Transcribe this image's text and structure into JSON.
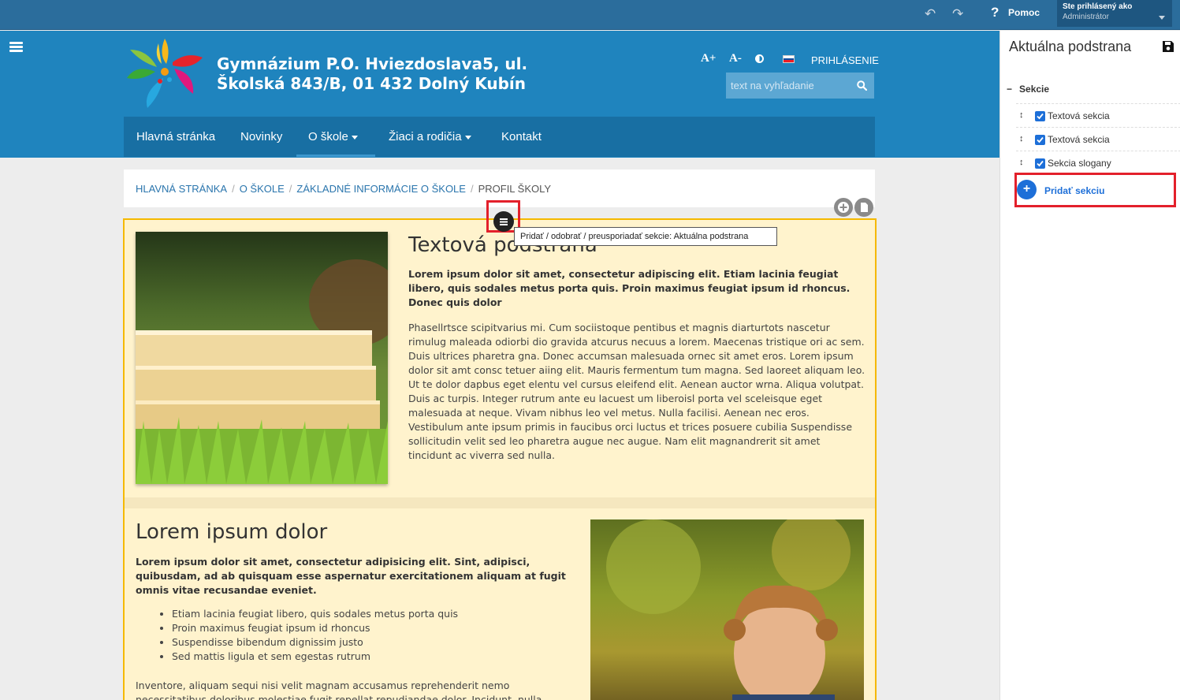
{
  "adminbar": {
    "help_label": "Pomoc",
    "user_line1": "Ste prihlásený ako",
    "user_line2": "Administrátor",
    "undo_icon": "undo-icon",
    "redo_icon": "redo-icon"
  },
  "site": {
    "title_line1": "Gymnázium P.O. Hviezdoslava5, ul.",
    "title_line2": "Školská 843/B, 01 432 Dolný Kubín",
    "a_plus": "A+",
    "a_minus": "A-",
    "login": "PRIHLÁSENIE",
    "search_placeholder": "text na vyhľadanie"
  },
  "nav": {
    "items": [
      {
        "label": "Hlavná stránka"
      },
      {
        "label": "Novinky"
      },
      {
        "label": "O škole"
      },
      {
        "label": "Žiaci a rodičia"
      },
      {
        "label": "Kontakt"
      }
    ]
  },
  "breadcrumb": {
    "items": [
      "HLAVNÁ STRÁNKA",
      "O ŠKOLE",
      "ZÁKLADNÉ INFORMÁCIE O ŠKOLE"
    ],
    "current": "PROFIL ŠKOLY"
  },
  "tooltip": "Pridať / odobrať / preusporiadať sekcie: Aktuálna podstrana",
  "section1": {
    "title": "Textová podstrana",
    "lead": "Lorem ipsum dolor sit amet, consectetur adipiscing elit. Etiam lacinia feugiat libero, quis sodales metus porta quis. Proin maximus feugiat ipsum id rhoncus. Donec quis dolor",
    "body": "Phasellrtsce scipitvarius mi. Cum sociistoque pentibus et magnis diarturtots nascetur rimulug maleada odiorbi dio gravida atcurus necuus a lorem. Maecenas tristique ori ac sem. Duis ultrices pharetra gna. Donec accumsan malesuada ornec sit amet eros. Lorem ipsum dolor sit amt consc tetuer aiing elit. Mauris fermentum tum magna. Sed laoreet aliquam leo. Ut te dolor dapbus eget elentu vel cursus eleifend elit. Aenean auctor wrna. Aliqua volutpat. Duis ac turpis. Integer rutrum ante eu lacuest um liberoisl porta vel sceleisque eget malesuada at neque. Vivam nibhus leo vel metus. Nulla facilisi. Aenean nec eros. Vestibulum ante ipsum primis in faucibus orci luctus et trices posuere cubilia Suspendisse sollicitudin velit sed leo pharetra augue nec augue. Nam elit magnandrerit sit amet tincidunt ac viverra sed nulla."
  },
  "section2": {
    "title": "Lorem ipsum dolor",
    "lead": "Lorem ipsum dolor sit amet, consectetur adipisicing elit. Sint, adipisci, quibusdam, ad ab quisquam esse aspernatur exercitationem aliquam at fugit omnis vitae recusandae eveniet.",
    "list": [
      "Etiam lacinia feugiat libero, quis sodales metus porta quis",
      "Proin maximus feugiat ipsum id rhoncus",
      "Suspendisse bibendum dignissim justo",
      "Sed mattis ligula et sem egestas rutrum"
    ],
    "body": "Inventore, aliquam sequi nisi velit magnam accusamus reprehenderit nemo necessitatibus doloribus molestiae fugit repellat repudiandae dolor. Incidunt, nulla."
  },
  "panel": {
    "title": "Aktuálna podstrana",
    "sections_header": "Sekcie",
    "sections": [
      {
        "label": "Textová sekcia",
        "checked": true
      },
      {
        "label": "Textová sekcia",
        "checked": true
      },
      {
        "label": "Sekcia slogany",
        "checked": true
      }
    ],
    "add_section": "Pridať sekciu"
  },
  "colors": {
    "accent": "#1f84be",
    "nav": "#186fa3",
    "highlight": "#e3202b",
    "content_bg": "#fff3cd",
    "link_blue": "#1d6fd8"
  }
}
